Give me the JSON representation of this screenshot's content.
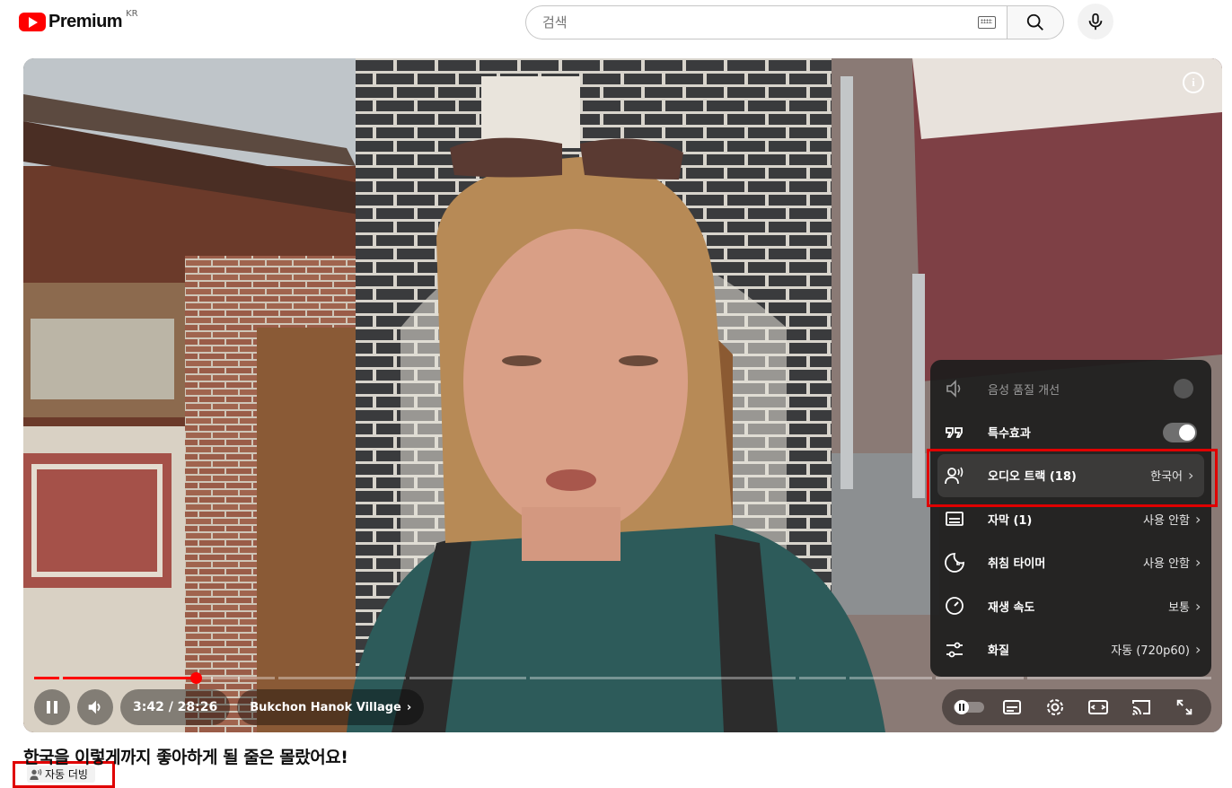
{
  "header": {
    "logo_text": "Premium",
    "country_code": "KR",
    "search_placeholder": "검색"
  },
  "player": {
    "time_display": "3:42 / 28:26",
    "chapter": "Bukchon Hanok Village",
    "progress_fraction": 0.13
  },
  "settings_menu": {
    "items": [
      {
        "label": "음성 품질 개선",
        "value": "",
        "icon": "voice-boost-icon",
        "state": "disabled-toggle"
      },
      {
        "label": "특수효과",
        "value": "",
        "icon": "special-effects-icon",
        "state": "toggle-on"
      },
      {
        "label": "오디오 트랙 (18)",
        "value": "한국어",
        "icon": "audio-track-icon",
        "state": "selected"
      },
      {
        "label": "자막 (1)",
        "value": "사용 안함",
        "icon": "subtitles-icon",
        "state": ""
      },
      {
        "label": "취침 타이머",
        "value": "사용 안함",
        "icon": "sleep-timer-icon",
        "state": ""
      },
      {
        "label": "재생 속도",
        "value": "보통",
        "icon": "playback-speed-icon",
        "state": ""
      },
      {
        "label": "화질",
        "value": "자동 (720p60)",
        "icon": "quality-icon",
        "state": ""
      }
    ]
  },
  "video": {
    "title": "한국을 이렇게까지 좋아하게 될 줄은 몰랐어요!",
    "dub_badge": "자동 더빙"
  },
  "colors": {
    "accent": "#ff0000",
    "highlight_box": "#e00000"
  }
}
